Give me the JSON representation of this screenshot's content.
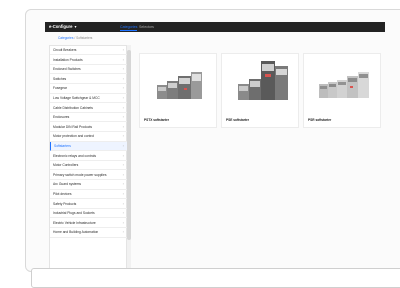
{
  "app": {
    "brand": "e-Configure",
    "tabs": [
      {
        "label": "Categories",
        "active": true
      },
      {
        "label": "Selectors",
        "active": false
      }
    ]
  },
  "breadcrumb": {
    "root": "Categories",
    "separator": "/",
    "current": "Softstarters"
  },
  "sidebar": {
    "items": [
      {
        "label": "Circuit Breakers"
      },
      {
        "label": "Installation Products"
      },
      {
        "label": "Enclosed Switches"
      },
      {
        "label": "Switches"
      },
      {
        "label": "Fusegear"
      },
      {
        "label": "Low Voltage Switchgear & MCC"
      },
      {
        "label": "Cable Distribution Cabinets"
      },
      {
        "label": "Enclosures"
      },
      {
        "label": "Modular DIN Rail Products"
      },
      {
        "label": "Motor protection and control"
      },
      {
        "label": "Softstarters",
        "active": true
      },
      {
        "label": "Electronic relays and controls"
      },
      {
        "label": "Motor Controllers"
      },
      {
        "label": "Primary switch mode power supplies"
      },
      {
        "label": "Arc Guard systems"
      },
      {
        "label": "Pilot devices"
      },
      {
        "label": "Safety Products"
      },
      {
        "label": "Industrial Plugs and Sockets"
      },
      {
        "label": "Electric Vehicle Infrastructure"
      },
      {
        "label": "Home and Building Automation"
      }
    ]
  },
  "products": [
    {
      "label": "PSTX softstarter"
    },
    {
      "label": "PSE softstarter"
    },
    {
      "label": "PSR softstarter"
    }
  ],
  "colors": {
    "topbar": "#232323",
    "accent": "#1f73ff",
    "active_item_bg": "#eef4ff"
  }
}
